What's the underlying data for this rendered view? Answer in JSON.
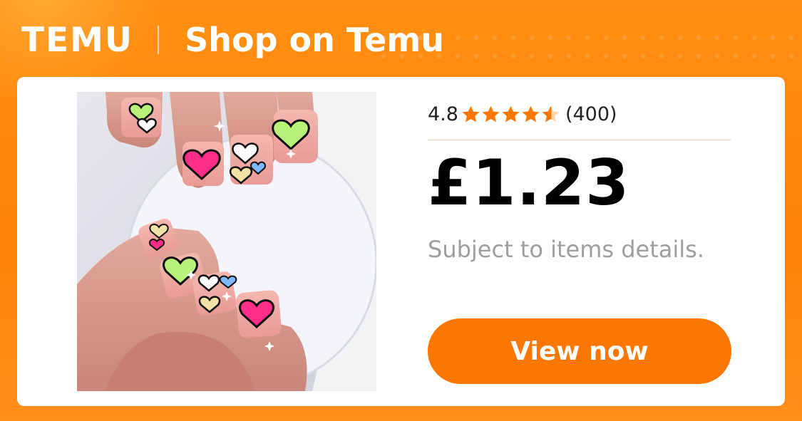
{
  "header": {
    "logo_text": "TEMU",
    "title": "Shop on Temu"
  },
  "product": {
    "image_icon": "nail-art-photo",
    "rating": "4.8",
    "stars": 4.5,
    "review_count": "(400)",
    "price": "£1.23",
    "subtext": "Subject to items details.",
    "cta_label": "View now"
  },
  "colors": {
    "brand_orange": "#fb7701",
    "background": "#ff8a0d",
    "star": "#fb7701",
    "subtext": "#9e9e9e"
  }
}
